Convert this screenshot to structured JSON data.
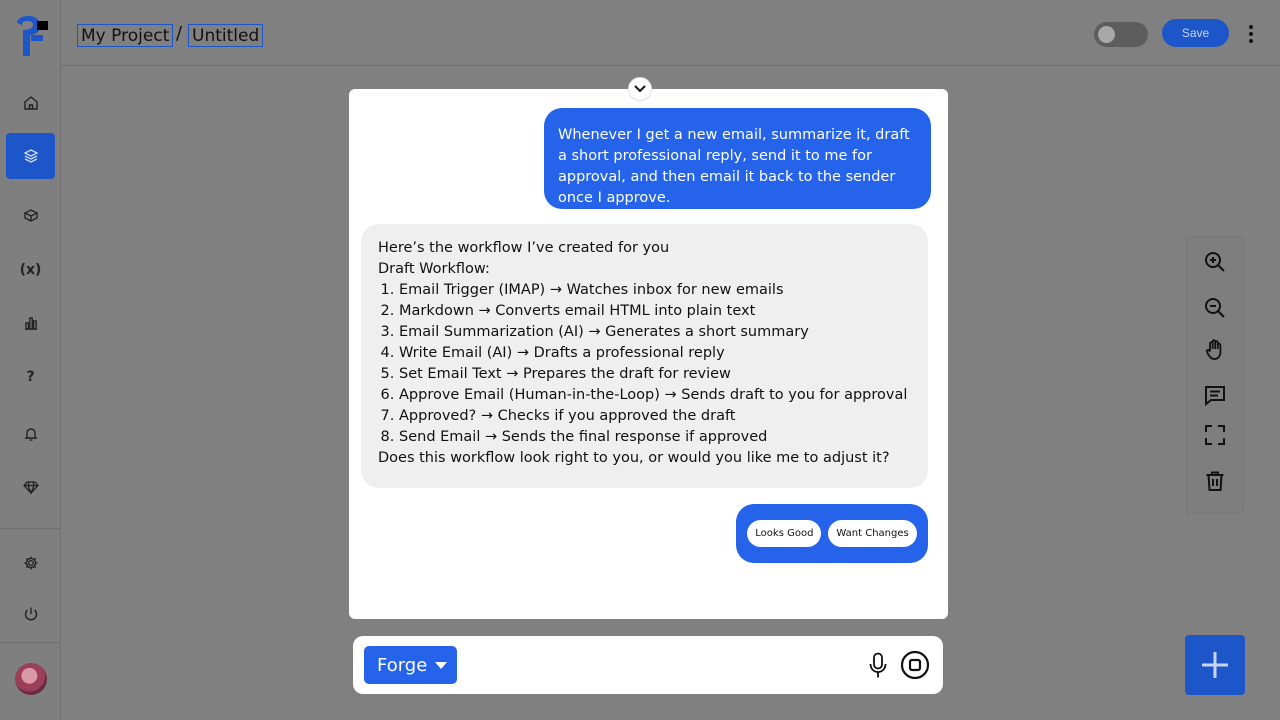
{
  "breadcrumb": {
    "project": "My Project",
    "separator": "/",
    "page": "Untitled"
  },
  "header": {
    "save_label": "Save",
    "toggle_state": "off"
  },
  "sidebar": {
    "items": [
      {
        "icon": "home-icon"
      },
      {
        "icon": "layers-icon",
        "active": true
      },
      {
        "icon": "box-icon"
      },
      {
        "label": "(x)",
        "icon": "variables-icon"
      },
      {
        "icon": "chart-icon"
      },
      {
        "label": "?",
        "icon": "help-icon"
      },
      {
        "icon": "bell-icon"
      },
      {
        "icon": "gem-icon"
      },
      {
        "icon": "gear-icon"
      },
      {
        "icon": "power-icon"
      }
    ]
  },
  "chat": {
    "user_message": "Whenever I get a new email, summarize it, draft a short professional reply, send it to me for approval, and then email it back to the sender once I approve.",
    "bot_intro": "Here’s the workflow I’ve created for you",
    "bot_heading": "Draft Workflow:",
    "steps": [
      "Email Trigger (IMAP) → Watches inbox for new emails",
      "Markdown → Converts email HTML into plain text",
      "Email Summarization (AI) → Generates a short summary",
      "Write Email (AI) → Drafts a professional reply",
      "Set Email Text → Prepares the draft for review",
      "Approve Email (Human-in-the-Loop) → Sends draft to you for approval",
      "Approved? → Checks if you approved the draft",
      "Send Email → Sends the final response if approved"
    ],
    "bot_question": "Does this workflow look right to you, or would you like me to adjust it?",
    "quick_replies": {
      "good": "Looks Good",
      "changes": "Want Changes"
    }
  },
  "input": {
    "agent": "Forge"
  },
  "colors": {
    "accent": "#2563eb",
    "overlay": "#808080"
  }
}
